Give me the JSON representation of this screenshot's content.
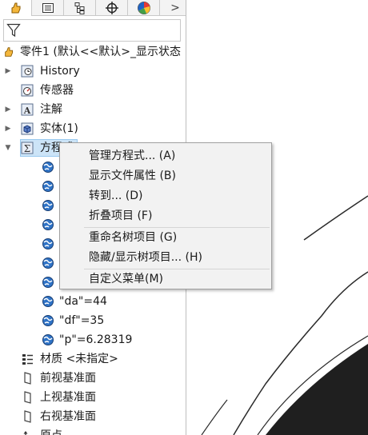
{
  "tabs": [
    {
      "name": "feature-manager-icon",
      "active": true
    },
    {
      "name": "property-manager-icon",
      "active": false
    },
    {
      "name": "configuration-manager-icon",
      "active": false
    },
    {
      "name": "dimxpert-icon",
      "active": false
    },
    {
      "name": "display-manager-icon",
      "active": false
    }
  ],
  "tab_more": ">",
  "filter_icon": "filter-icon",
  "tree": {
    "root_label": "零件1 (默认<<默认>_显示状态",
    "history": "History",
    "sensors": "传感器",
    "annotations": "注解",
    "solid_bodies": "实体(1)",
    "equations": "方程式",
    "eq_da": "\"da\"=44",
    "eq_df": "\"df\"=35",
    "eq_p": "\"p\"=6.28319",
    "material": "材质 <未指定>",
    "front_plane": "前视基准面",
    "top_plane": "上视基准面",
    "right_plane": "右视基准面",
    "origin": "原点"
  },
  "context_menu": {
    "manage_equations": "管理方程式... (A)",
    "doc_properties": "显示文件属性 (B)",
    "goto": "转到... (D)",
    "collapse": "折叠项目 (F)",
    "rename_tree": "重命名树项目 (G)",
    "hide_show_tree": "隐藏/显示树项目... (H)",
    "customize_menu": "自定义菜单(M)"
  },
  "colors": {
    "selection_bg": "#cce4f7",
    "menu_bg": "#f2f2f2"
  }
}
